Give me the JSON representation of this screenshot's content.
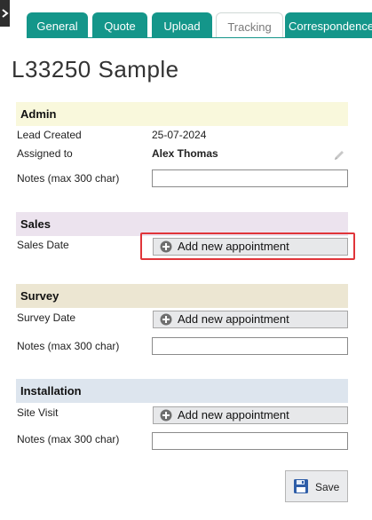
{
  "tabs": [
    {
      "label": "General"
    },
    {
      "label": "Quote"
    },
    {
      "label": "Upload"
    },
    {
      "label": "Tracking"
    },
    {
      "label": "Correspondence"
    }
  ],
  "active_tab": "Tracking",
  "page_title": "L33250 Sample",
  "admin": {
    "title": "Admin",
    "lead_created_label": "Lead Created",
    "lead_created_value": "25-07-2024",
    "assigned_to_label": "Assigned to",
    "assigned_to_value": "Alex Thomas",
    "notes_label": "Notes (max 300 char)",
    "notes_value": "",
    "header_color": "#f9f8dc"
  },
  "sales": {
    "title": "Sales",
    "date_label": "Sales Date",
    "button_label": "Add new appointment",
    "header_color": "#ece3ee"
  },
  "survey": {
    "title": "Survey",
    "date_label": "Survey Date",
    "button_label": "Add new appointment",
    "notes_label": "Notes (max 300 char)",
    "notes_value": "",
    "header_color": "#ece6d2"
  },
  "installation": {
    "title": "Installation",
    "visit_label": "Site Visit",
    "button_label": "Add new appointment",
    "notes_label": "Notes (max 300 char)",
    "notes_value": "",
    "header_color": "#dde5ee"
  },
  "save_label": "Save",
  "icons": {
    "corner": "chevron-right-icon",
    "edit": "pencil-icon",
    "add": "plus-circle-icon",
    "save": "floppy-disk-icon"
  },
  "colors": {
    "tab_active": "#14968a",
    "highlight": "#e0353a"
  }
}
